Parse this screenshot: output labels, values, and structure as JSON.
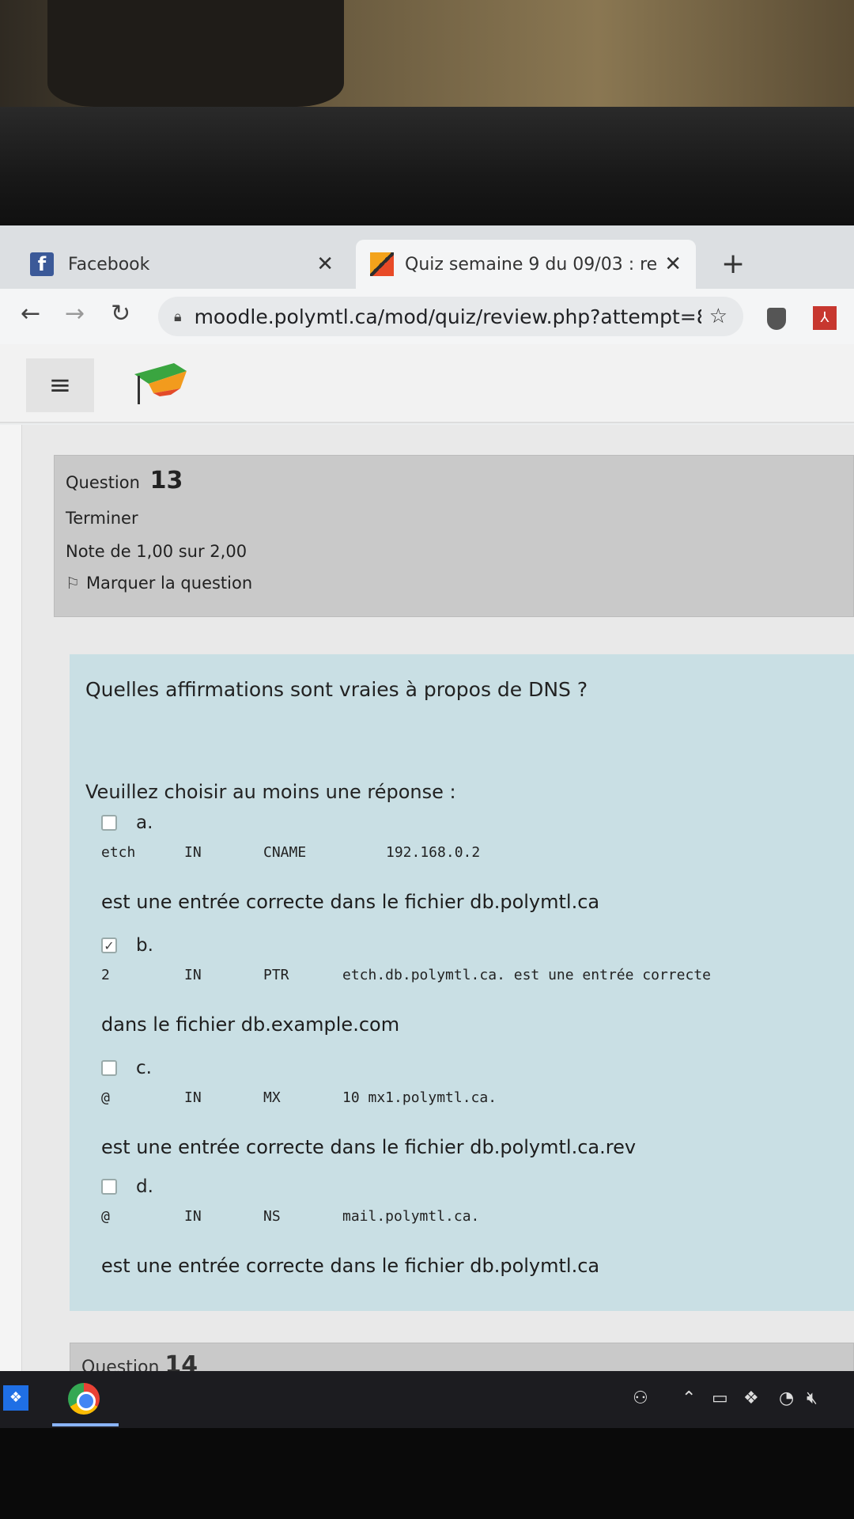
{
  "browser": {
    "tabs": [
      {
        "label": "Facebook",
        "icon": "facebook-icon",
        "active": false
      },
      {
        "label": "Quiz semaine 9 du 09/03 : relectu",
        "icon": "moodle-icon",
        "active": true
      }
    ],
    "url": "moodle.polymtl.ca/mod/quiz/review.php?attempt=8..."
  },
  "question": {
    "label": "Question",
    "number": "13",
    "status": "Terminer",
    "grade": "Note de 1,00 sur 2,00",
    "flag_label": "Marquer la question",
    "text": "Quelles affirmations sont vraies à propos de DNS ?",
    "prompt": "Veuillez choisir au moins une réponse :",
    "answers": [
      {
        "letter": "a.",
        "checked": false,
        "record": [
          "etch",
          "IN",
          "CNAME",
          "192.168.0.2"
        ],
        "tail": "est une entrée correcte dans le fichier db.polymtl.ca"
      },
      {
        "letter": "b.",
        "checked": true,
        "record": [
          "2",
          "IN",
          "PTR",
          "etch.db.polymtl.ca. est une entrée correcte"
        ],
        "tail": "dans le fichier db.example.com"
      },
      {
        "letter": "c.",
        "checked": false,
        "record": [
          "@",
          "IN",
          "MX",
          "10 mx1.polymtl.ca."
        ],
        "tail": "est une entrée correcte dans le fichier db.polymtl.ca.rev"
      },
      {
        "letter": "d.",
        "checked": false,
        "record": [
          "@",
          "IN",
          "NS",
          "mail.polymtl.ca."
        ],
        "tail": "est une entrée correcte dans le fichier db.polymtl.ca"
      }
    ]
  },
  "next_question": {
    "label": "Question",
    "number": "14"
  }
}
